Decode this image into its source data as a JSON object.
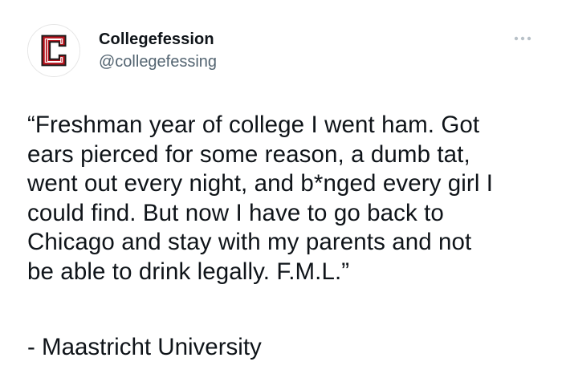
{
  "account": {
    "display_name": "Collegefession",
    "handle": "@collegefessing",
    "avatar_letter": "C",
    "avatar_color": "#b5121b"
  },
  "menu": {
    "icon": "more-horizontal-icon"
  },
  "tweet": {
    "lines": [
      "“Freshman year of college I went ham. Got",
      "ears pierced for some reason, a dumb tat,",
      "went out every night, and b*nged every girl I",
      "could find. But now I have to go back to",
      "Chicago and stay with my parents and not",
      "be able to drink legally. F.M.L.”"
    ],
    "attribution": "- Maastricht University"
  }
}
